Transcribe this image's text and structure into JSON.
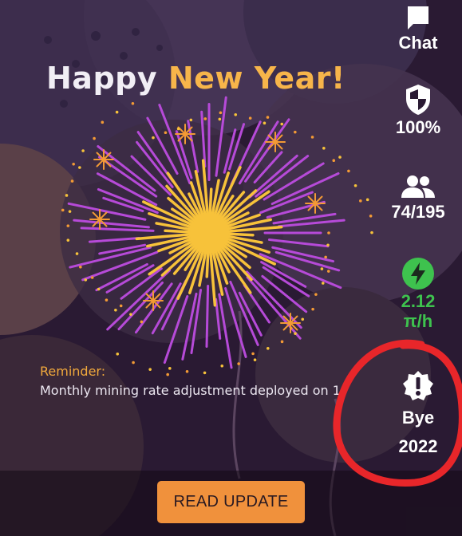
{
  "banner": {
    "title_white": "Happy",
    "title_yellow": "New Year!"
  },
  "reminder": {
    "label": "Reminder:",
    "text": "Monthly mining rate adjustment deployed on 1"
  },
  "read_update_label": "READ UPDATE",
  "sidebar": {
    "chat": {
      "label": "Chat",
      "icon": "chat-bubble-icon"
    },
    "security": {
      "value": "100%",
      "icon": "shield-icon"
    },
    "team": {
      "value": "74/195",
      "icon": "people-icon"
    },
    "mining_rate": {
      "value": "2.12",
      "unit": "π/h",
      "icon": "lightning-icon",
      "color": "#3ec24e"
    },
    "notice": {
      "line1": "Bye",
      "line2": "2022",
      "icon": "alert-badge-icon"
    }
  },
  "colors": {
    "background": "#2a1a33",
    "accent_orange": "#f0913c",
    "title_yellow": "#f7b54a",
    "firework_purple": "#b64ad8",
    "firework_gold": "#f7c23a",
    "annotation_red": "#e8262a"
  }
}
